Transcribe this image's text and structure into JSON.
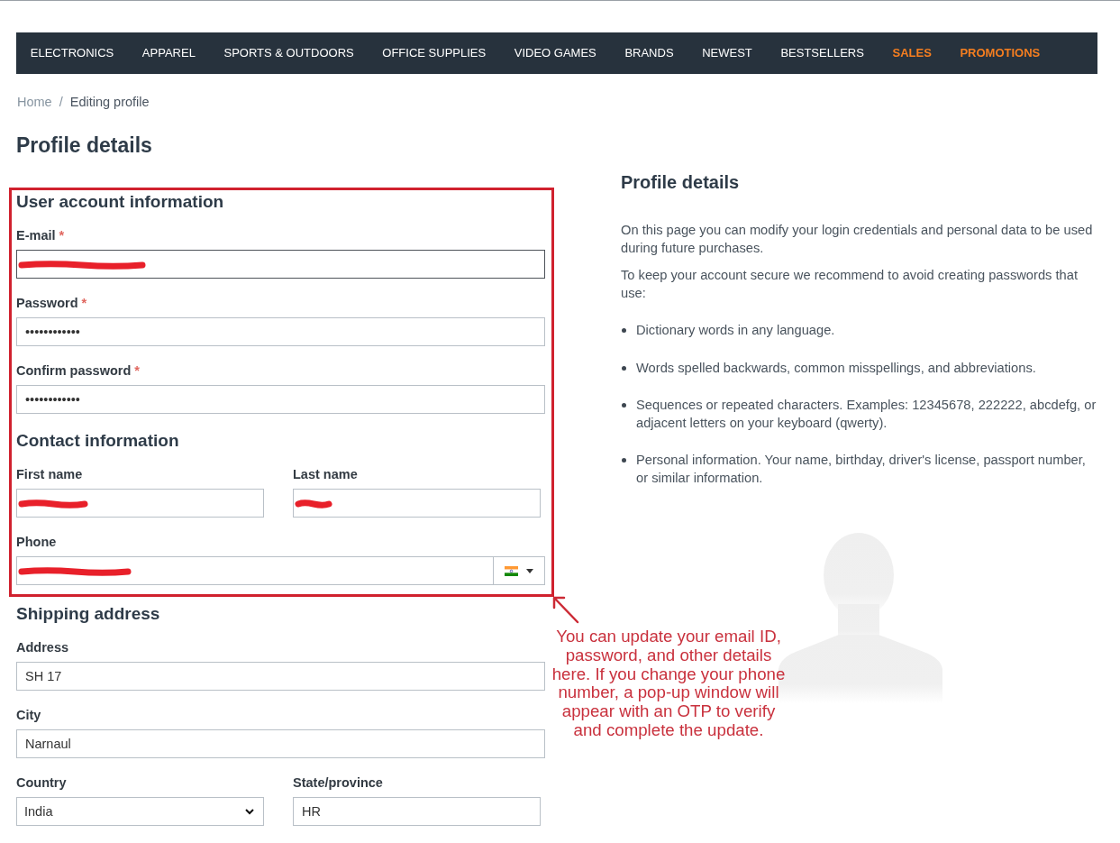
{
  "nav": {
    "items": [
      {
        "label": "ELECTRONICS",
        "highlighted": false
      },
      {
        "label": "APPAREL",
        "highlighted": false
      },
      {
        "label": "SPORTS & OUTDOORS",
        "highlighted": false
      },
      {
        "label": "OFFICE SUPPLIES",
        "highlighted": false
      },
      {
        "label": "VIDEO GAMES",
        "highlighted": false
      },
      {
        "label": "BRANDS",
        "highlighted": false
      },
      {
        "label": "NEWEST",
        "highlighted": false
      },
      {
        "label": "BESTSELLERS",
        "highlighted": false
      },
      {
        "label": "SALES",
        "highlighted": true
      },
      {
        "label": "PROMOTIONS",
        "highlighted": true
      }
    ]
  },
  "breadcrumb": {
    "separator": "/",
    "items": [
      {
        "label": "Home",
        "kind": "link"
      },
      {
        "label": "Editing profile",
        "kind": "current"
      }
    ]
  },
  "page_title": "Profile details",
  "form": {
    "groups": [
      {
        "annotated": true,
        "sections": [
          {
            "title": "User account information",
            "rows": [
              [
                {
                  "label": "E-mail",
                  "required_mark": "*",
                  "kind": "text",
                  "focused": true,
                  "redacted": true
                }
              ],
              [
                {
                  "label": "Password",
                  "required_mark": "*",
                  "kind": "password",
                  "value": "••••••••••••",
                  "focused": false,
                  "redacted": false
                }
              ],
              [
                {
                  "label": "Confirm password",
                  "required_mark": "*",
                  "kind": "password",
                  "value": "••••••••••••",
                  "focused": false,
                  "redacted": false
                }
              ]
            ]
          },
          {
            "title": "Contact information",
            "rows": [
              [
                {
                  "label": "First name",
                  "kind": "text",
                  "focused": false,
                  "redacted": true
                },
                {
                  "label": "Last name",
                  "kind": "text",
                  "focused": false,
                  "redacted": true
                }
              ],
              [
                {
                  "label": "Phone",
                  "kind": "phone",
                  "focused": false,
                  "redacted": true
                }
              ]
            ]
          }
        ]
      },
      {
        "annotated": false,
        "sections": [
          {
            "title": "Shipping address",
            "rows": [
              [
                {
                  "label": "Address",
                  "kind": "text",
                  "value": "SH 17",
                  "focused": false,
                  "redacted": false
                }
              ],
              [
                {
                  "label": "City",
                  "kind": "text",
                  "value": "Narnaul",
                  "focused": false,
                  "redacted": false
                }
              ],
              [
                {
                  "label": "Country",
                  "kind": "select",
                  "value": "India",
                  "focused": false,
                  "redacted": false
                },
                {
                  "label": "State/province",
                  "kind": "text",
                  "value": "HR",
                  "focused": false,
                  "redacted": false
                }
              ]
            ]
          }
        ]
      }
    ]
  },
  "sidebar": {
    "title": "Profile details",
    "paragraphs": [
      "On this page you can modify your login credentials and personal data to be used during future purchases.",
      "To keep your account secure we recommend to avoid creating passwords that use:"
    ],
    "tips": [
      "Dictionary words in any language.",
      "Words spelled backwards, common misspellings, and abbreviations.",
      "Sequences or repeated characters. Examples: 12345678, 222222, abcdefg, or adjacent letters on your keyboard (qwerty).",
      "Personal information. Your name, birthday, driver's license, passport number, or similar information."
    ]
  },
  "annotation": {
    "text": "You can update your email ID, password, and other details here. If you change your phone number, a pop-up window will appear with an OTP to verify and complete the update."
  }
}
